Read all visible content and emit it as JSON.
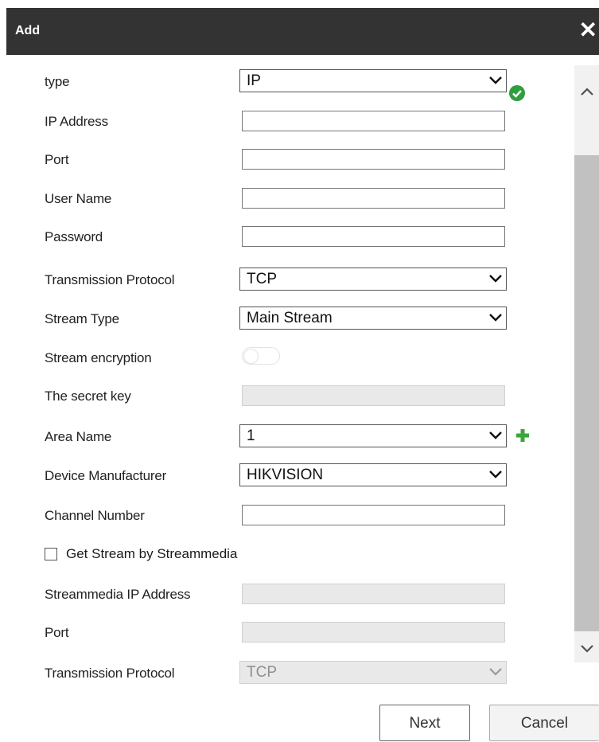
{
  "dialog": {
    "title": "Add",
    "close_label": "✕"
  },
  "form": {
    "type": {
      "label": "type",
      "value": "IP"
    },
    "ip_address": {
      "label": "IP Address",
      "value": ""
    },
    "port": {
      "label": "Port",
      "value": ""
    },
    "user_name": {
      "label": "User Name",
      "value": ""
    },
    "password": {
      "label": "Password",
      "value": ""
    },
    "transmission_protocol": {
      "label": "Transmission Protocol",
      "value": "TCP"
    },
    "stream_type": {
      "label": "Stream Type",
      "value": "Main Stream"
    },
    "stream_encryption": {
      "label": "Stream encryption",
      "enabled": false
    },
    "secret_key": {
      "label": "The secret key",
      "value": ""
    },
    "area_name": {
      "label": "Area Name",
      "value": "1"
    },
    "device_manufacturer": {
      "label": "Device Manufacturer",
      "value": "HIKVISION"
    },
    "channel_number": {
      "label": "Channel Number",
      "value": ""
    },
    "get_stream": {
      "label": "Get Stream by Streammedia",
      "checked": false
    },
    "streammedia_ip": {
      "label": "Streammedia IP Address",
      "value": ""
    },
    "streammedia_port": {
      "label": "Port",
      "value": ""
    },
    "streammedia_protocol": {
      "label": "Transmission Protocol",
      "value": "TCP"
    }
  },
  "buttons": {
    "next": "Next",
    "cancel": "Cancel"
  },
  "colors": {
    "header_bg": "#333333",
    "valid_green": "#2e9e3e",
    "add_green": "#3aa63a"
  },
  "icons": [
    "close-icon",
    "check-circle-icon",
    "plus-icon",
    "chevron-down-icon",
    "chevron-up-icon"
  ]
}
